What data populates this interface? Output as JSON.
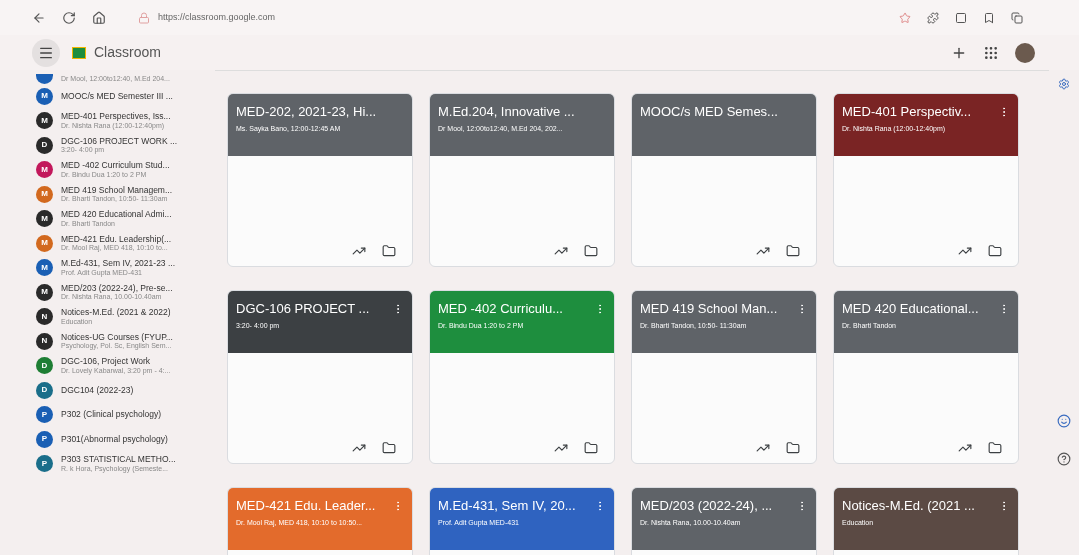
{
  "browser": {
    "url": "https://classroom.google.com"
  },
  "app": {
    "title": "Classroom"
  },
  "sidebar": {
    "items": [
      {
        "subtitle": "Dr Mool, 12:00to12:40, M.Ed 204...",
        "color": "#1a5fb4"
      },
      {
        "letter": "M",
        "title": "MOOC/s MED Semester III ...",
        "color": "#1a5fb4"
      },
      {
        "letter": "M",
        "title": "MED-401 Perspectives, Iss...",
        "subtitle": "Dr. Nishta Rana (12:00-12:40pm)",
        "color": "#2a2a2a"
      },
      {
        "letter": "D",
        "title": "DGC-106 PROJECT WORK ...",
        "subtitle": "3:20- 4:00 pm",
        "color": "#2a2a2a"
      },
      {
        "letter": "M",
        "title": "MED -402 Curriculum Stud...",
        "subtitle": "Dr. Bindu Dua 1:20 to 2 PM",
        "color": "#c2185b"
      },
      {
        "letter": "M",
        "title": "MED 419 School Managem...",
        "subtitle": "Dr. Bharti Tandon, 10:50- 11:30am",
        "color": "#d2691e"
      },
      {
        "letter": "M",
        "title": "MED 420 Educational Admi...",
        "subtitle": "Dr. Bharti Tandon",
        "color": "#2a2a2a"
      },
      {
        "letter": "M",
        "title": "MED-421 Edu. Leadership(...",
        "subtitle": "Dr. Mool Raj, MED 418, 10:10 to...",
        "color": "#d2691e"
      },
      {
        "letter": "M",
        "title": "M.Ed-431, Sem IV, 2021-23 ...",
        "subtitle": "Prof. Adit Gupta MED-431",
        "color": "#1a5fb4"
      },
      {
        "letter": "M",
        "title": "MED/203 (2022-24), Pre-se...",
        "subtitle": "Dr. Nishta Rana, 10.00-10.40am",
        "color": "#2a2a2a"
      },
      {
        "letter": "N",
        "title": "Notices-M.Ed. (2021 & 2022)",
        "subtitle": "Education",
        "color": "#2a2a2a"
      },
      {
        "letter": "N",
        "title": "Notices-UG Courses (FYUP...",
        "subtitle": "Psychology, Pol. Sc, English Sem...",
        "color": "#2a2a2a"
      },
      {
        "letter": "D",
        "title": "DGC-106, Project Work",
        "subtitle": "Dr. Lovely Kabarwal, 3:20 pm - 4:...",
        "color": "#1e7e34"
      },
      {
        "letter": "D",
        "title": "DGC104 (2022-23)",
        "color": "#1a6e8a"
      },
      {
        "letter": "P",
        "title": "P302 (Clinical psychology)",
        "color": "#1a5fb4"
      },
      {
        "letter": "P",
        "title": "P301(Abnormal psychology)",
        "color": "#1a5fb4"
      },
      {
        "letter": "P",
        "title": "P303 STATISTICAL METHO...",
        "subtitle": "R. k Hora, Psychology (Semeste...",
        "color": "#1a6e8a"
      }
    ]
  },
  "cards": [
    {
      "title": "MED-202, 2021-23, Hi...",
      "subtitle": "Ms. Sayka Bano, 12:00-12:45 AM",
      "color": "#5f6368",
      "menu": false
    },
    {
      "title": "M.Ed.204, Innovative ...",
      "subtitle": "Dr Mool, 12:00to12:40, M.Ed 204, 202...",
      "color": "#5f6368",
      "menu": false
    },
    {
      "title": "MOOC/s MED Semes...",
      "color": "#5f6368",
      "menu": false
    },
    {
      "title": "MED-401 Perspectiv...",
      "subtitle": "Dr. Nishta Rana (12:00-12:40pm)",
      "color": "#7a2424",
      "menu": true
    },
    {
      "title": "DGC-106 PROJECT ...",
      "subtitle": "3:20- 4:00 pm",
      "color": "#3c4043",
      "menu": true
    },
    {
      "title": "MED -402 Curriculu...",
      "subtitle": "Dr. Bindu Dua 1:20 to 2 PM",
      "color": "#1e8e3e",
      "menu": true
    },
    {
      "title": "MED 419 School Man...",
      "subtitle": "Dr. Bharti Tandon, 10:50- 11:30am",
      "color": "#5f6368",
      "menu": true
    },
    {
      "title": "MED 420 Educational...",
      "subtitle": "Dr. Bharti Tandon",
      "color": "#5f6368",
      "menu": true
    },
    {
      "title": "MED-421 Edu. Leader...",
      "subtitle": "Dr. Mool Raj, MED 418, 10:10 to 10:50...",
      "color": "#e36b2c",
      "menu": true
    },
    {
      "title": "M.Ed-431, Sem IV, 20...",
      "subtitle": "Prof. Adit Gupta MED-431",
      "color": "#2f63c0",
      "menu": true
    },
    {
      "title": "MED/203 (2022-24), ...",
      "subtitle": "Dr. Nishta Rana, 10.00-10.40am",
      "color": "#5f6368",
      "menu": true
    },
    {
      "title": "Notices-M.Ed. (2021 ...",
      "subtitle": "Education",
      "color": "#5b4a44",
      "menu": true
    }
  ]
}
